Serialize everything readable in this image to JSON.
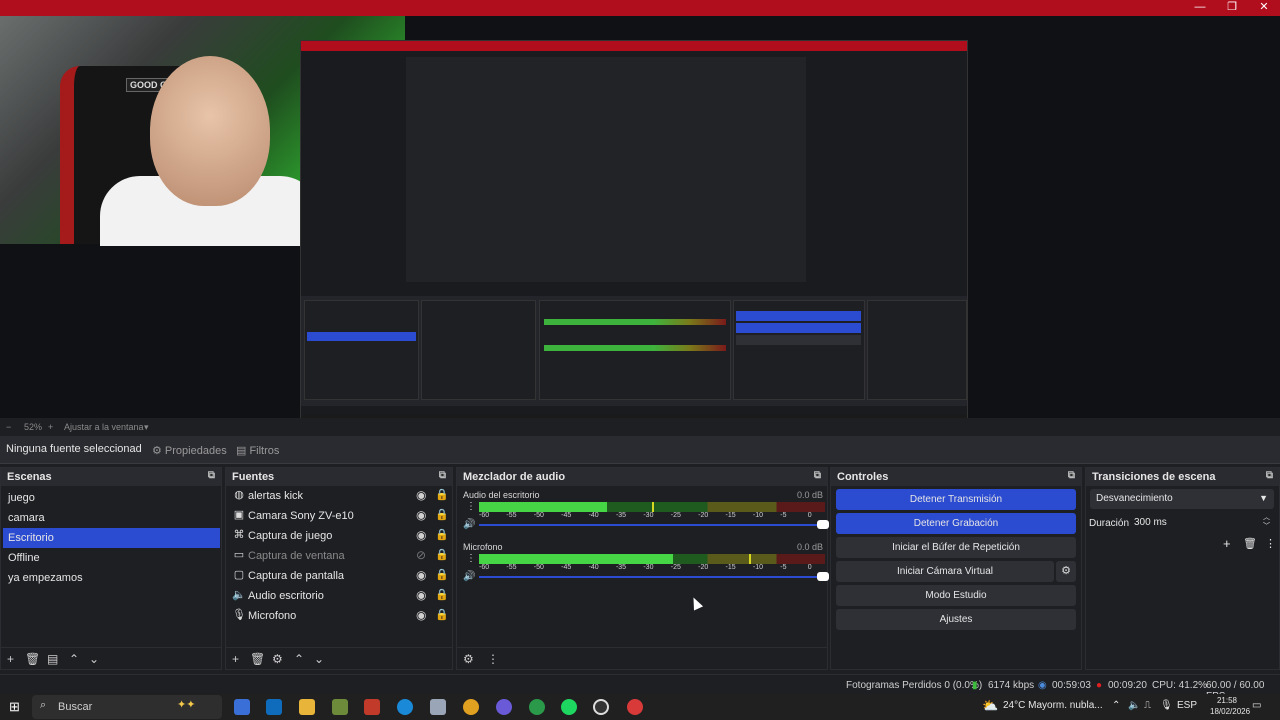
{
  "window": {
    "minimize_icon": "minimize-icon",
    "maximize_icon": "restore-icon",
    "close_icon": "close-icon"
  },
  "preview": {
    "webcam_sign": "GOOD GAME",
    "zoom": "52%",
    "fit_label": "Ajustar a la ventana"
  },
  "propbar": {
    "no_source": "Ninguna fuente seleccionad",
    "properties": "Propiedades",
    "filters": "Filtros"
  },
  "scenes": {
    "title": "Escenas",
    "items": [
      "juego",
      "camara",
      "Escritorio",
      "Offline",
      "ya empezamos"
    ],
    "active": "Escritorio"
  },
  "sources": {
    "title": "Fuentes",
    "items": [
      {
        "label": "alertas kick",
        "icon": "browser-icon",
        "visible": true
      },
      {
        "label": "Camara Sony ZV-e10",
        "icon": "camera-icon",
        "visible": true
      },
      {
        "label": "Captura de juego",
        "icon": "gamepad-icon",
        "visible": true
      },
      {
        "label": "Captura de ventana",
        "icon": "window-icon",
        "visible": false
      },
      {
        "label": "Captura de pantalla",
        "icon": "monitor-icon",
        "visible": true
      },
      {
        "label": "Audio escritorio",
        "icon": "speaker-icon",
        "visible": true
      },
      {
        "label": "Microfono",
        "icon": "mic-icon",
        "visible": true
      }
    ]
  },
  "mixer": {
    "title": "Mezclador de audio",
    "tracks": [
      {
        "name": "Audio del escritorio",
        "db": "0.0 dB",
        "level": 0.37,
        "peak": 0.5
      },
      {
        "name": "Microfono",
        "db": "0.0 dB",
        "level": 0.56,
        "peak": 0.78
      }
    ],
    "scale": [
      "-60",
      "-55",
      "-50",
      "-45",
      "-40",
      "-35",
      "-30",
      "-25",
      "-20",
      "-15",
      "-10",
      "-5",
      "0"
    ]
  },
  "controls": {
    "title": "Controles",
    "stop_stream": "Detener Transmisión",
    "stop_record": "Detener Grabación",
    "replay_buffer": "Iniciar el Búfer de Repetición",
    "virtual_cam": "Iniciar Cámara Virtual",
    "studio_mode": "Modo Estudio",
    "settings": "Ajustes"
  },
  "transitions": {
    "title": "Transiciones de escena",
    "selected": "Desvanecimiento",
    "duration_label": "Duración",
    "duration_value": "300 ms"
  },
  "status": {
    "dropped": "Fotogramas Perdidos 0 (0.0%)",
    "bitrate": "6174 kbps",
    "stream_time": "00:59:03",
    "rec_time": "00:09:20",
    "cpu": "CPU: 41.2%",
    "fps": "60.00 / 60.00 FPS"
  },
  "taskbar": {
    "search": "Buscar",
    "weather": "24°C  Mayorm. nubla...",
    "lang": "ESP",
    "time": "21:58",
    "date": "18/02/2026"
  },
  "colors": {
    "accent": "#2b4bd0",
    "title_red": "#b00d1d",
    "panel_bg": "#1e1f23"
  }
}
